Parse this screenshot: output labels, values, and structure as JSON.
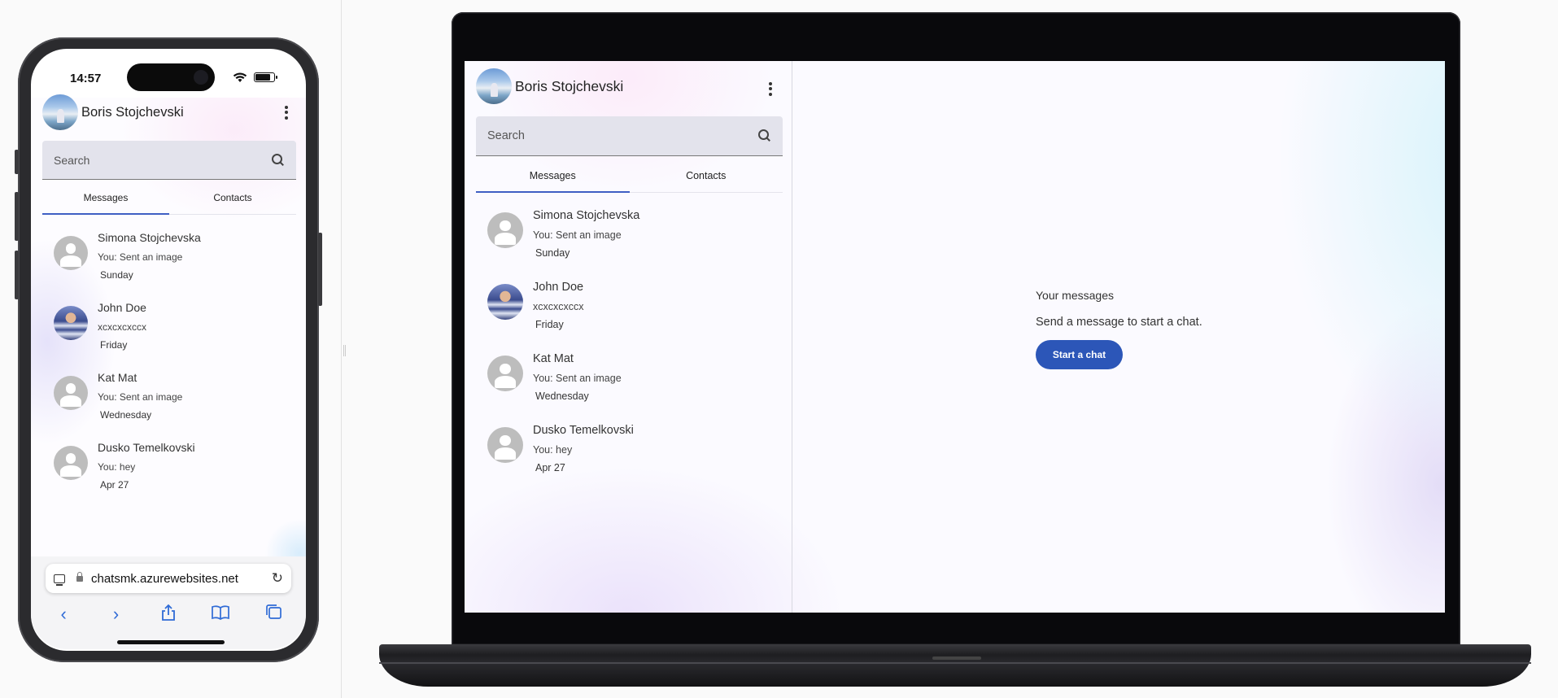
{
  "phone": {
    "status": {
      "time": "14:57"
    },
    "url": "chatsmk.azurewebsites.net"
  },
  "app": {
    "user": {
      "name": "Boris Stojchevski"
    },
    "search": {
      "placeholder": "Search"
    },
    "tabs": [
      {
        "label": "Messages",
        "active": true
      },
      {
        "label": "Contacts",
        "active": false
      }
    ],
    "conversations": [
      {
        "name": "Simona Stojchevska",
        "message": "You: Sent an image",
        "date": "Sunday",
        "avatar": "default-avatar-icon"
      },
      {
        "name": "John Doe",
        "message": "xcxcxcxccx",
        "date": "Friday",
        "avatar": "photo"
      },
      {
        "name": "Kat Mat",
        "message": "You: Sent an image",
        "date": "Wednesday",
        "avatar": "default-avatar-icon"
      },
      {
        "name": "Dusko Temelkovski",
        "message": "You: hey",
        "date": "Apr 27",
        "avatar": "default-avatar-icon"
      }
    ],
    "empty_state": {
      "heading": "Your messages",
      "subtext": "Send a message to start a chat.",
      "button": "Start a chat"
    },
    "colors": {
      "accent": "#2c56b8",
      "tab_indicator": "#3f5fc4",
      "safari_blue": "#2f6bd6"
    }
  }
}
